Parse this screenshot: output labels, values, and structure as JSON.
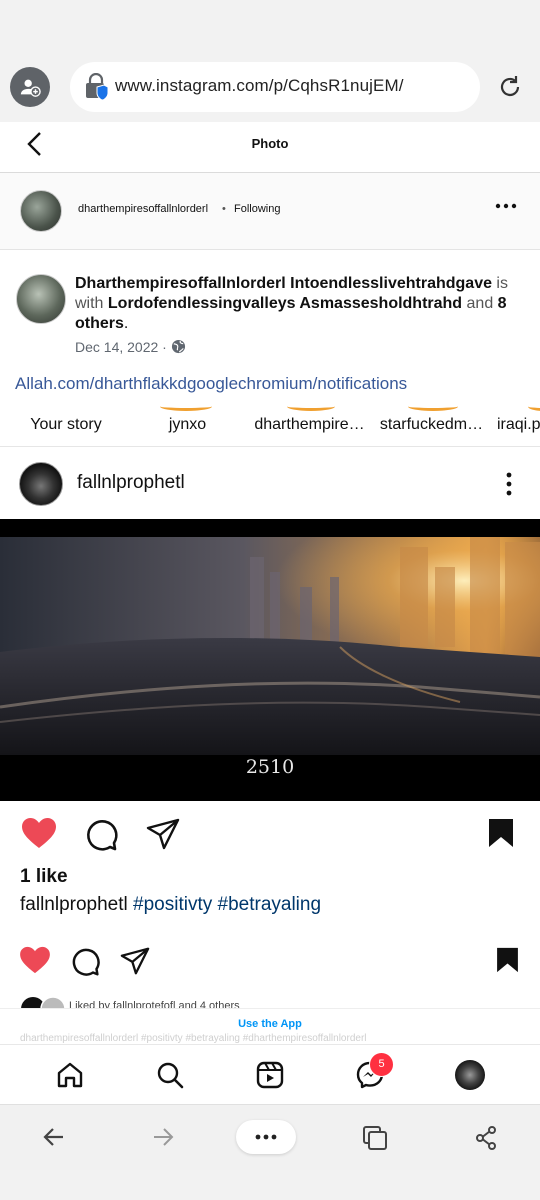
{
  "browser": {
    "url": "www.instagram.com/p/CqhsR1nujEM/",
    "icons": {
      "account": "account-add-icon",
      "lock": "lock-shield-icon",
      "reload": "reload-icon"
    }
  },
  "header": {
    "title": "Photo"
  },
  "author": {
    "username": "dharthempiresoffallnlorderl",
    "separator": "•",
    "following_label": "Following"
  },
  "caption_card": {
    "name_part": "Dharthempiresoffallnlorderl Intoendlesslivehtrahdgave",
    "with_text": " is with ",
    "tagged": "Lordofendlessingvalleys Asmassesholdhtrahd",
    "and_text": " and ",
    "others_part": "8 others",
    "period": ".",
    "date": "Dec 14, 2022 ·",
    "link": "Allah.com/dharthflakkdgooglechromium/notifications"
  },
  "stories": [
    {
      "label": "Your story"
    },
    {
      "label": "jynxo"
    },
    {
      "label": "dharthempire…"
    },
    {
      "label": "starfuckedm…"
    },
    {
      "label": "iraqi.p"
    }
  ],
  "post": {
    "username": "fallnlprophetl",
    "image_caption": "2510",
    "likes": "1 like",
    "caption_user": "fallnlprophetl",
    "hashtags": [
      "#positivty",
      "#betrayaling"
    ],
    "liked_by": "Liked by fallnlprotefofl and 4 others"
  },
  "banner": {
    "use_app": "Use the App",
    "faded": "dharthempiresoffallnlorderl #positivty #betrayaling #dharthempiresoffallnlorderl"
  },
  "nav": {
    "messenger_badge": "5"
  },
  "colors": {
    "like_red": "#ed4956",
    "link_blue": "#385898",
    "hashtag": "#00376b",
    "app_blue": "#0095f6",
    "badge": "#ff3040",
    "story_ring": "#f0a030"
  }
}
